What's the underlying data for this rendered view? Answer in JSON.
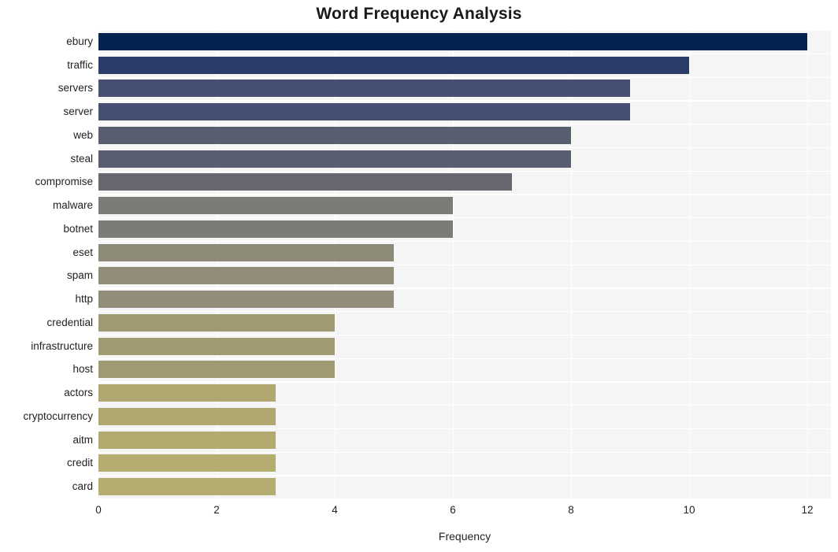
{
  "chart_data": {
    "type": "bar",
    "orientation": "horizontal",
    "title": "Word Frequency Analysis",
    "xlabel": "Frequency",
    "ylabel": "",
    "categories": [
      "ebury",
      "traffic",
      "servers",
      "server",
      "web",
      "steal",
      "compromise",
      "malware",
      "botnet",
      "eset",
      "spam",
      "http",
      "credential",
      "infrastructure",
      "host",
      "actors",
      "cryptocurrency",
      "aitm",
      "credit",
      "card"
    ],
    "values": [
      12,
      10,
      9,
      9,
      8,
      8,
      7,
      6,
      6,
      5,
      5,
      5,
      4,
      4,
      4,
      3,
      3,
      3,
      3,
      3
    ],
    "bar_colors": [
      "#04234e",
      "#2b3c6b",
      "#454f72",
      "#454f72",
      "#585d70",
      "#585d70",
      "#67686f",
      "#7b7b78",
      "#7b7b78",
      "#8d8a77",
      "#918d78",
      "#918d7a",
      "#a09a73",
      "#a09a73",
      "#a09a72",
      "#b0a771",
      "#b0a771",
      "#b3aa70",
      "#b5ac6f",
      "#b5ac6f"
    ],
    "xticks": [
      0,
      2,
      4,
      6,
      8,
      10,
      12
    ],
    "xlim": [
      0,
      12.4
    ],
    "grid": true,
    "legend": false,
    "plot_background": "#f5f5f6",
    "gridline_color": "#ffffff",
    "figure_background": "#ffffff"
  }
}
